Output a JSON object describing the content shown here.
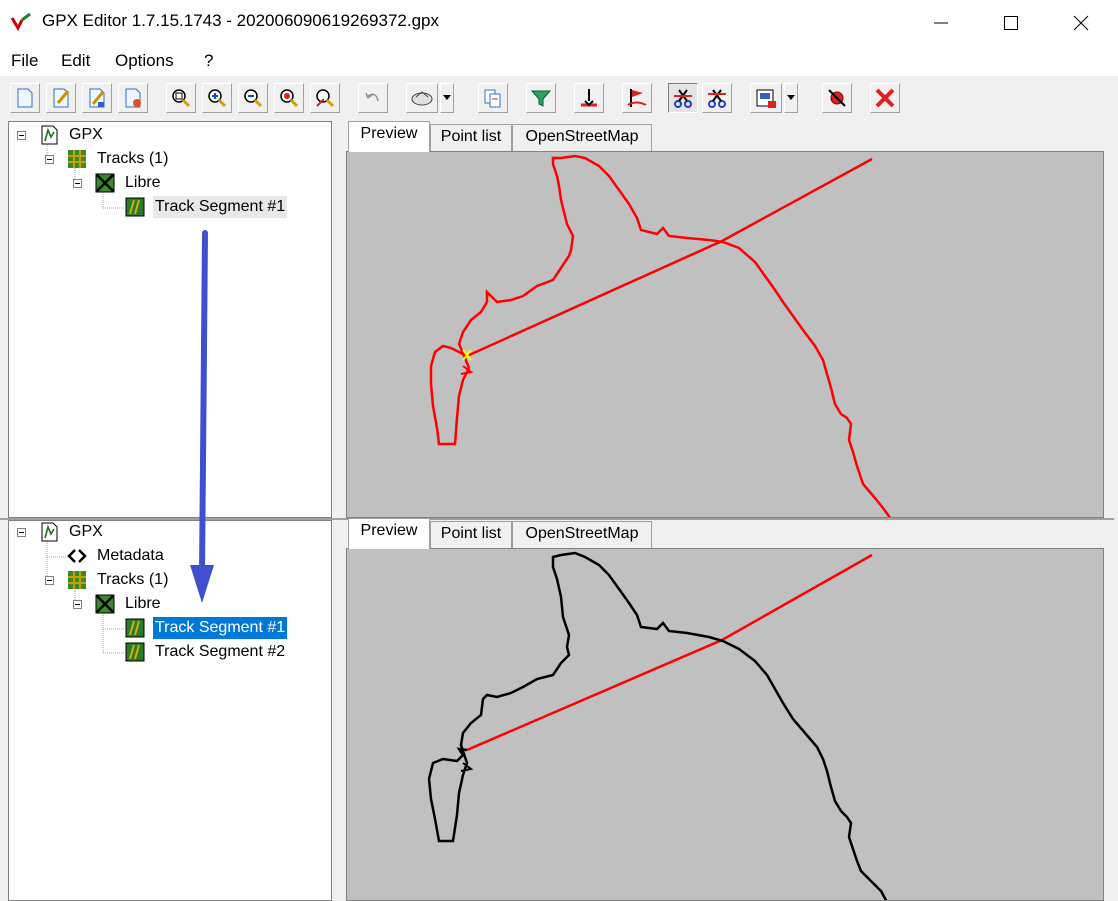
{
  "window": {
    "title": "GPX Editor 1.7.15.1743 - 202006090619269372.gpx",
    "controls": [
      "minimize",
      "maximize",
      "close"
    ]
  },
  "menu": {
    "items": [
      {
        "label": "File"
      },
      {
        "label": "Edit"
      },
      {
        "label": "Options"
      },
      {
        "label": "?"
      }
    ]
  },
  "toolbar": {
    "buttons": [
      {
        "icon": "new-file-icon"
      },
      {
        "icon": "edit-file-icon"
      },
      {
        "icon": "edit-file-alt-icon"
      },
      {
        "icon": "save-file-icon"
      },
      {
        "icon": "zoom-fit-icon"
      },
      {
        "icon": "zoom-in-icon"
      },
      {
        "icon": "zoom-out-icon"
      },
      {
        "icon": "zoom-select-icon"
      },
      {
        "icon": "zoom-tool-icon"
      },
      {
        "icon": "undo-icon"
      },
      {
        "icon": "shape-icon"
      },
      {
        "icon": "copy-icon"
      },
      {
        "icon": "filter-icon"
      },
      {
        "icon": "split-point-icon"
      },
      {
        "icon": "flag-icon"
      },
      {
        "icon": "cut-track-icon"
      },
      {
        "icon": "cut-segment-icon"
      },
      {
        "icon": "save-map-icon"
      },
      {
        "icon": "no-icon"
      },
      {
        "icon": "delete-icon"
      }
    ]
  },
  "top": {
    "tree": {
      "root": "GPX",
      "tracks": "Tracks (1)",
      "track": "Libre",
      "segment1": "Track Segment #1"
    },
    "tabs": [
      "Preview",
      "Point list",
      "OpenStreetMap"
    ],
    "active_tab": "Preview",
    "track_color": "#ff0000"
  },
  "bottom": {
    "tree": {
      "root": "GPX",
      "metadata": "Metadata",
      "tracks": "Tracks (1)",
      "track": "Libre",
      "segment1": "Track Segment #1",
      "segment2": "Track Segment #2"
    },
    "tabs": [
      "Preview",
      "Point list",
      "OpenStreetMap"
    ],
    "active_tab": "Preview",
    "segment1_color": "#000000",
    "segment2_color": "#ff0000"
  },
  "annotation": {
    "arrow_color": "#3f4fd0"
  },
  "colors": {
    "selection": "#0078d7",
    "map_background": "#c0c0c0"
  }
}
